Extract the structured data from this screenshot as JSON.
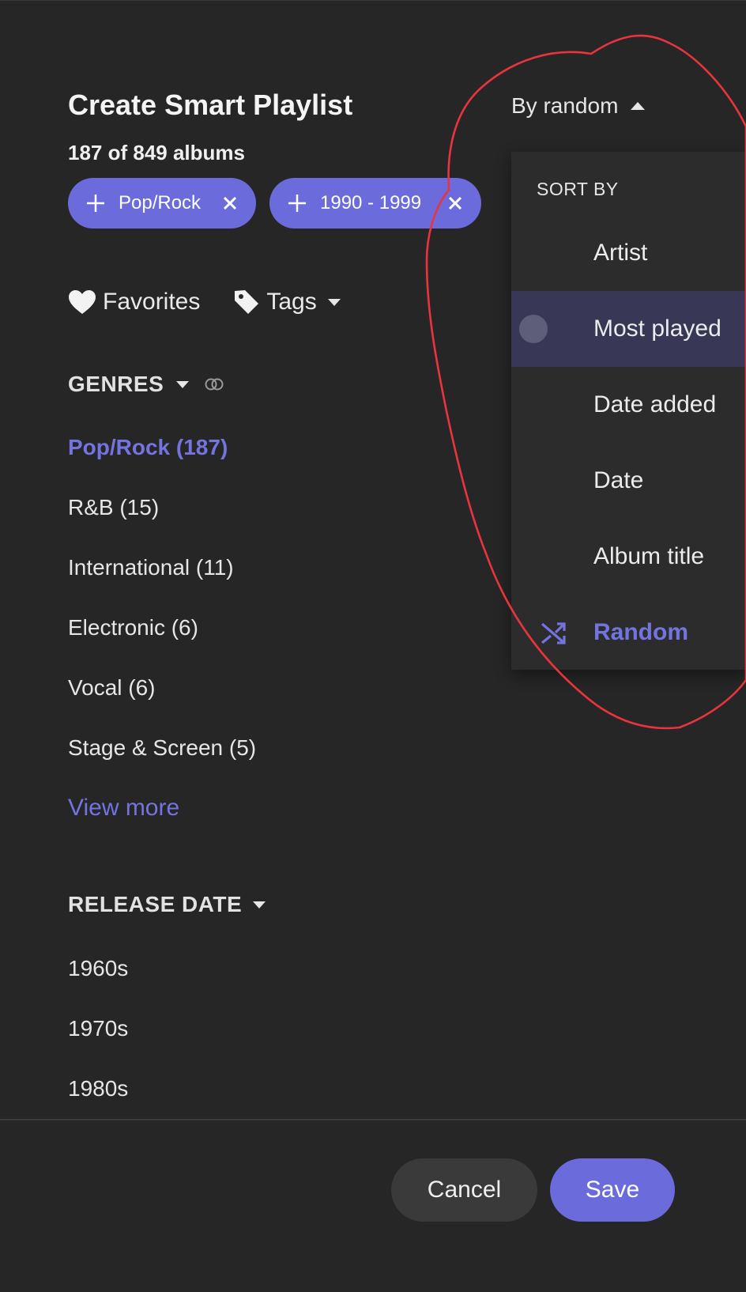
{
  "header": {
    "title": "Create Smart Playlist",
    "album_count": "187 of 849 albums"
  },
  "active_filters": [
    {
      "label": "Pop/Rock"
    },
    {
      "label": "1990 - 1999"
    }
  ],
  "filters": {
    "favorites_label": "Favorites",
    "tags_label": "Tags"
  },
  "genres": {
    "heading": "GENRES",
    "items": [
      {
        "label": "Pop/Rock (187)",
        "active": true
      },
      {
        "label": "R&B (15)"
      },
      {
        "label": "International (11)"
      },
      {
        "label": "Electronic (6)"
      },
      {
        "label": "Vocal (6)"
      },
      {
        "label": "Stage & Screen (5)"
      }
    ],
    "view_more": "View more"
  },
  "release_date": {
    "heading": "RELEASE DATE",
    "items": [
      "1960s",
      "1970s",
      "1980s"
    ]
  },
  "sort": {
    "trigger_label": "By random",
    "menu_header": "SORT BY",
    "options": [
      "Artist",
      "Most played",
      "Date added",
      "Date",
      "Album title",
      "Random"
    ],
    "highlighted": "Most played",
    "selected": "Random"
  },
  "actions": {
    "cancel": "Cancel",
    "save": "Save"
  },
  "colors": {
    "background": "#262626",
    "accent": "#6b6bdb",
    "accent_text": "#7474e0",
    "annotation": "#e8343c"
  }
}
